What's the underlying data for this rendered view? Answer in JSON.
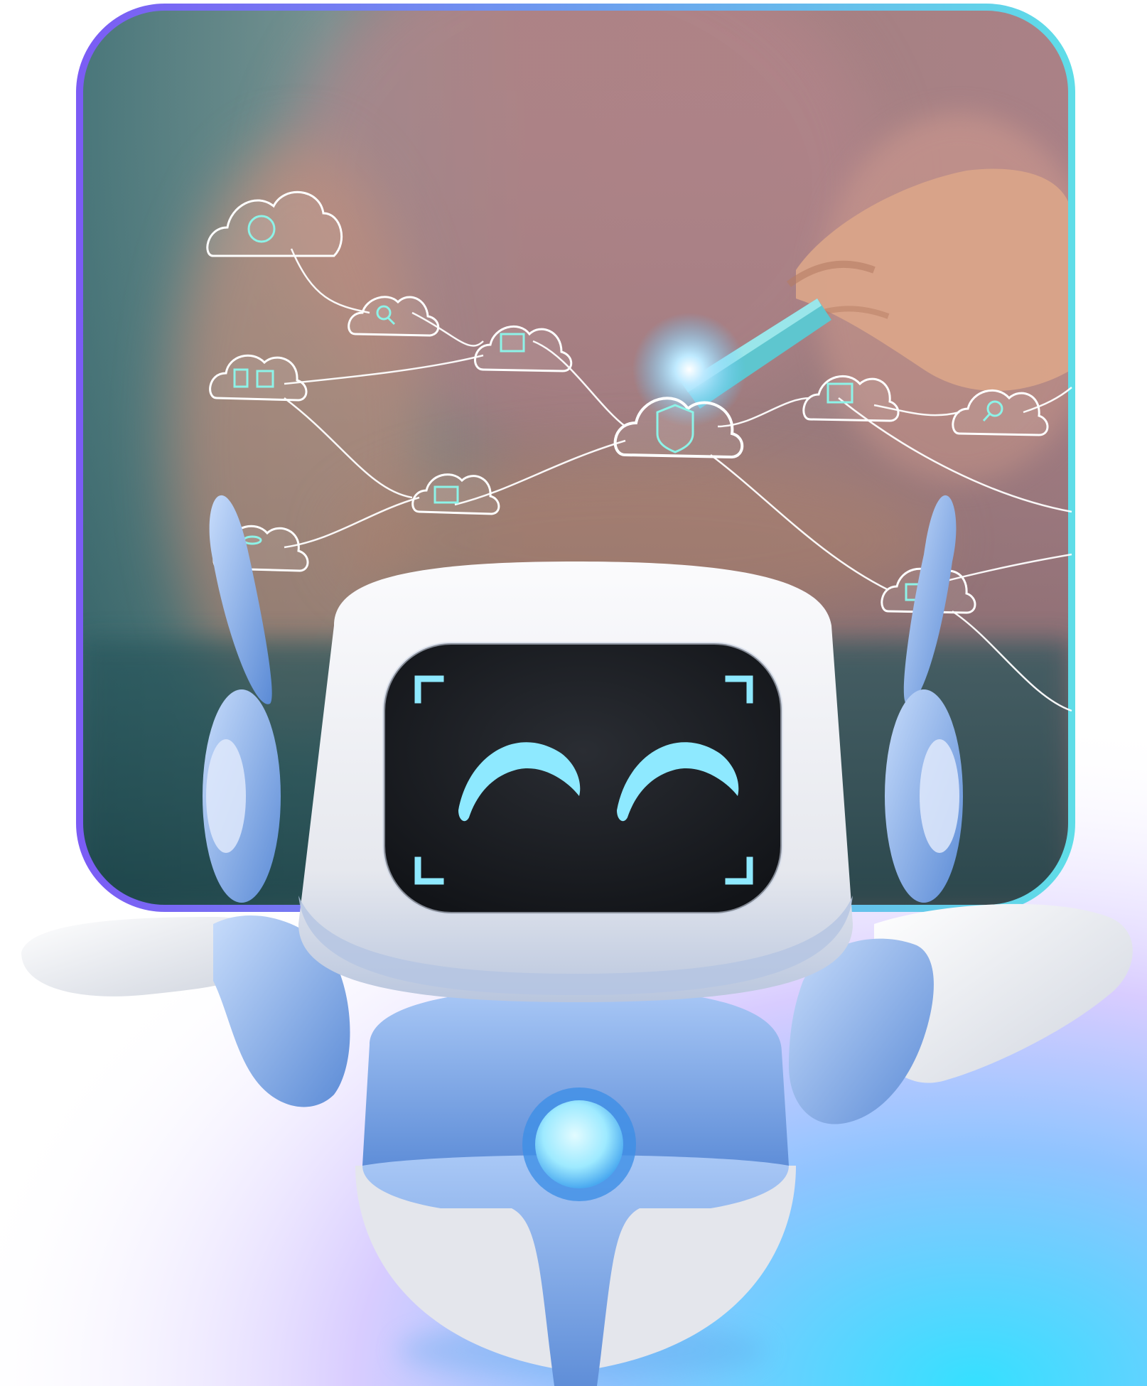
{
  "scene": {
    "subject": "robot-mascot",
    "photo_content": "hand-with-stylus-touching-cloud-network",
    "robot_expression": "happy-closed-eyes",
    "network_icons": [
      "shield-icon",
      "search-icon",
      "monitor-chart-icon",
      "file-database-icon",
      "lock-shield-icon",
      "mail-icon",
      "database-gear-icon",
      "search-icon",
      "monitor-chart-icon",
      "mail-icon"
    ]
  },
  "colors": {
    "frame_gradient_start": "#7b5cf5",
    "frame_gradient_end": "#5fdde8",
    "background_glow_bottom": "#35e0ff",
    "background_glow_mid": "#a9a6ff",
    "robot_white": "#f2f3f7",
    "robot_blue": "#79a8ec",
    "robot_screen": "#1c1e22",
    "robot_eyes": "#8ee9ff",
    "chest_light": "#b8f4ff"
  }
}
